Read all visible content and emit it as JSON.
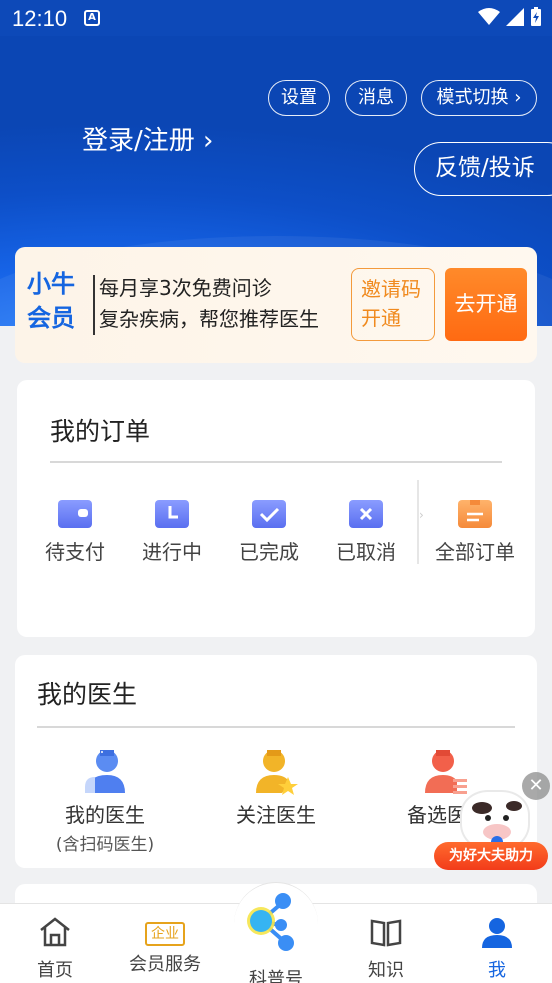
{
  "status_bar": {
    "time": "12:10",
    "a_icon": "A"
  },
  "header": {
    "settings": "设置",
    "messages": "消息",
    "mode_switch": "模式切换",
    "login": "登录/注册",
    "feedback": "反馈/投诉"
  },
  "member": {
    "title": "小牛会员",
    "line1": "每月享3次免费问诊",
    "line2": "复杂疾病，帮您推荐医生",
    "invite": "邀请码开通",
    "open": "去开通"
  },
  "orders": {
    "title": "我的订单",
    "items": [
      {
        "label": "待支付",
        "icon": "wallet-icon"
      },
      {
        "label": "进行中",
        "icon": "clock-icon"
      },
      {
        "label": "已完成",
        "icon": "check-icon"
      },
      {
        "label": "已取消",
        "icon": "cancel-icon"
      },
      {
        "label": "全部订单",
        "icon": "clipboard-icon"
      }
    ]
  },
  "doctors": {
    "title": "我的医生",
    "items": [
      {
        "label": "我的医生",
        "sub": "(含扫码医生)",
        "icon": "doctor-icon"
      },
      {
        "label": "关注医生",
        "icon": "doctor-star-icon"
      },
      {
        "label": "备选医生",
        "icon": "doctor-list-icon"
      }
    ]
  },
  "promo": {
    "text": "为好大夫助力",
    "close": "✕"
  },
  "tabbar": [
    {
      "label": "首页",
      "icon": "home-icon"
    },
    {
      "label": "会员服务",
      "icon": "enterprise-icon",
      "badge": "企业"
    },
    {
      "label": "科普号",
      "icon": "molecule-icon"
    },
    {
      "label": "知识",
      "icon": "book-icon"
    },
    {
      "label": "我",
      "icon": "person-icon"
    }
  ],
  "colors": {
    "primary": "#1565e0",
    "accent_orange": "#ff6a12",
    "header_blue": "#0d49b8"
  }
}
